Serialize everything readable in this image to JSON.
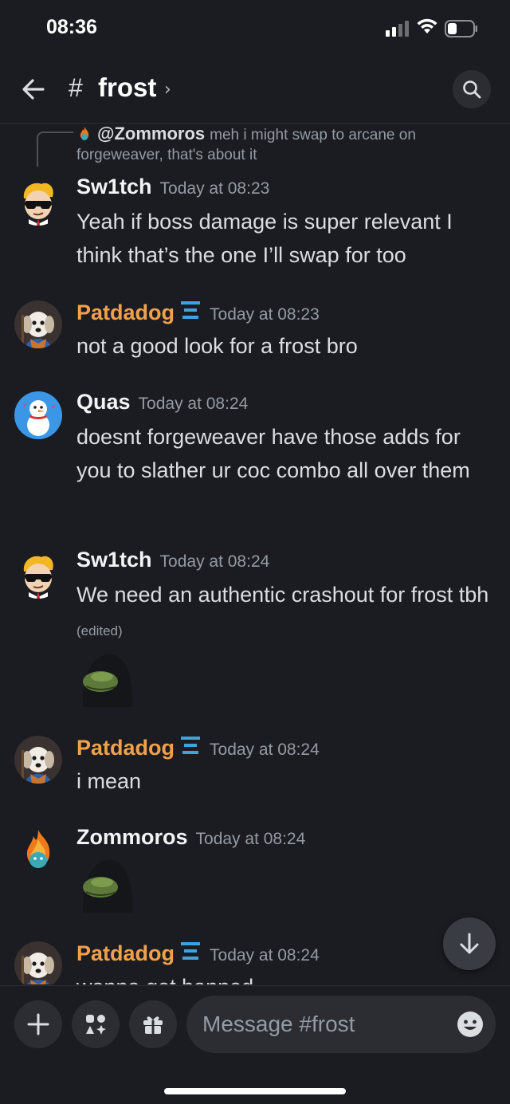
{
  "status": {
    "time": "08:36"
  },
  "header": {
    "hash": "#",
    "channel": "frost",
    "chevron": "›"
  },
  "reply": {
    "name": "@Zommoros",
    "text": "meh i might swap to arcane on forgeweaver, that's about it"
  },
  "messages": [
    {
      "author": "Sw1tch",
      "time": "Today at 08:23",
      "text": "Yeah if boss damage is super relevant I think that’s the one I’ll swap for too"
    },
    {
      "author": "Patdadog",
      "time": "Today at 08:23",
      "text": "not a good look for a frost bro"
    },
    {
      "author": "Quas",
      "time": "Today at 08:24",
      "text": "doesnt forgeweaver have those adds for you to slather ur coc combo all over them"
    },
    {
      "author": "Sw1tch",
      "time": "Today at 08:24",
      "text": "We need an authentic crashout for frost tbh",
      "edited": "(edited)"
    },
    {
      "author": "Patdadog",
      "time": "Today at 08:24",
      "text": "i mean"
    },
    {
      "author": "Zommoros",
      "time": "Today at 08:24",
      "text": ""
    },
    {
      "author": "Patdadog",
      "time": "Today at 08:24",
      "text": "wanna get banned"
    }
  ],
  "composer": {
    "placeholder": "Message #frost"
  },
  "colors": {
    "background": "#1b1c21",
    "username_orange": "#f0a14a",
    "timestamp": "#949ba4",
    "text": "#dbdee1"
  },
  "icons": [
    "back-arrow-icon",
    "search-icon",
    "scroll-down-icon",
    "plus-icon",
    "apps-icon",
    "gift-icon",
    "emoji-icon",
    "signal-icon",
    "wifi-icon",
    "battery-icon"
  ]
}
